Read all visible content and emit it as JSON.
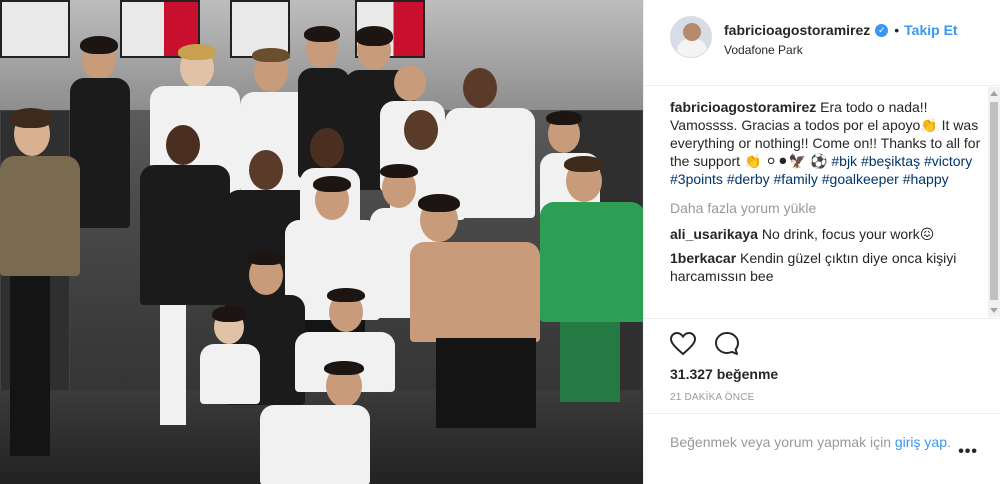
{
  "post": {
    "username": "fabricioagostoramirez",
    "follow_label": "Takip Et",
    "dot": "•",
    "location": "Vodafone Park"
  },
  "caption": {
    "username": "fabricioagostoramirez",
    "text": " Era todo o nada!! Vamossss. Gracias a todos por el apoyo👏 It was everything or nothing!! Come on!! Thanks to all for the support 👏 ⚪⚫🦅 ⚽ ",
    "hashtags": "#bjk #beşiktaş #victory #3points #derby #family #goalkeeper #happy"
  },
  "load_more": "Daha fazla yorum yükle",
  "comments": [
    {
      "username": "ali_usarikaya",
      "text": " No drink, focus your work😖"
    },
    {
      "username": "1berkacar",
      "text": " Kendin güzel çıktın diye onca kişiyi harcamıssın bee"
    }
  ],
  "likes": "31.327 beğenme",
  "time": "21 DAKİKA ÖNCE",
  "add_comment": {
    "text": "Beğenmek veya yorum yapmak için ",
    "login": "giriş yap",
    "after": "."
  },
  "more_options": "•••",
  "icons": {
    "heart": "heart-icon",
    "comment": "comment-icon",
    "verified": "verified-badge-icon"
  },
  "colors": {
    "link": "#3897f0",
    "hashtag": "#003569",
    "muted": "#999999"
  }
}
